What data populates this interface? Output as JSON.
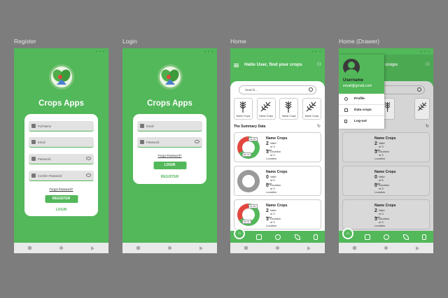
{
  "labels": {
    "register": "Register",
    "login": "Login",
    "home": "Home",
    "drawer": "Home (Drawer)"
  },
  "app": {
    "title": "Crops Apps"
  },
  "register": {
    "fields": {
      "full_name": "Full Name",
      "email": "Email",
      "password": "Password",
      "confirm_password": "Confirm Password"
    },
    "forgot": "Forgot Password?",
    "button": "REGISTER",
    "link": "LOGIN"
  },
  "login": {
    "fields": {
      "email": "Email",
      "password": "Password"
    },
    "forgot": "Forgot Password?",
    "button": "LOGIN",
    "link": "REGISTER"
  },
  "home": {
    "greeting": "Hello User, find your crops",
    "search_placeholder": "Search...",
    "crop_name": "Name Crops",
    "summary_title": "The Summary Data",
    "summary": [
      {
        "name": "Name Crops",
        "valid_count": "2",
        "valid_line1": "Valid",
        "valid_line2": "of 3 Data",
        "loc_count": "3",
        "loc_line1": "Location",
        "loc_line2": "of 3 Location",
        "pct_red": "33.3%",
        "pct_green": "66.7%",
        "valid_fraction": 0.667
      },
      {
        "name": "Name Crops",
        "valid_count": "0",
        "valid_line1": "Valid",
        "valid_line2": "of 5 Data",
        "loc_count": "0",
        "loc_line1": "Location",
        "loc_line2": "of 3 Location",
        "pct_red": "",
        "pct_green": "",
        "valid_fraction": 0
      },
      {
        "name": "Name Crops",
        "valid_count": "2",
        "valid_line1": "Valid",
        "valid_line2": "of 3 Data",
        "loc_count": "3",
        "loc_line1": "Location",
        "loc_line2": "of 3 Location",
        "pct_red": "33.3%",
        "pct_green": "66.7%",
        "valid_fraction": 0.667
      }
    ]
  },
  "drawer": {
    "username": "Username",
    "email": "email@gmail.com",
    "items": [
      "Profile",
      "Data crops",
      "Log-out"
    ]
  },
  "colors": {
    "primary": "#52b85a",
    "red": "#e2473f",
    "gray": "#9a9a9a"
  }
}
